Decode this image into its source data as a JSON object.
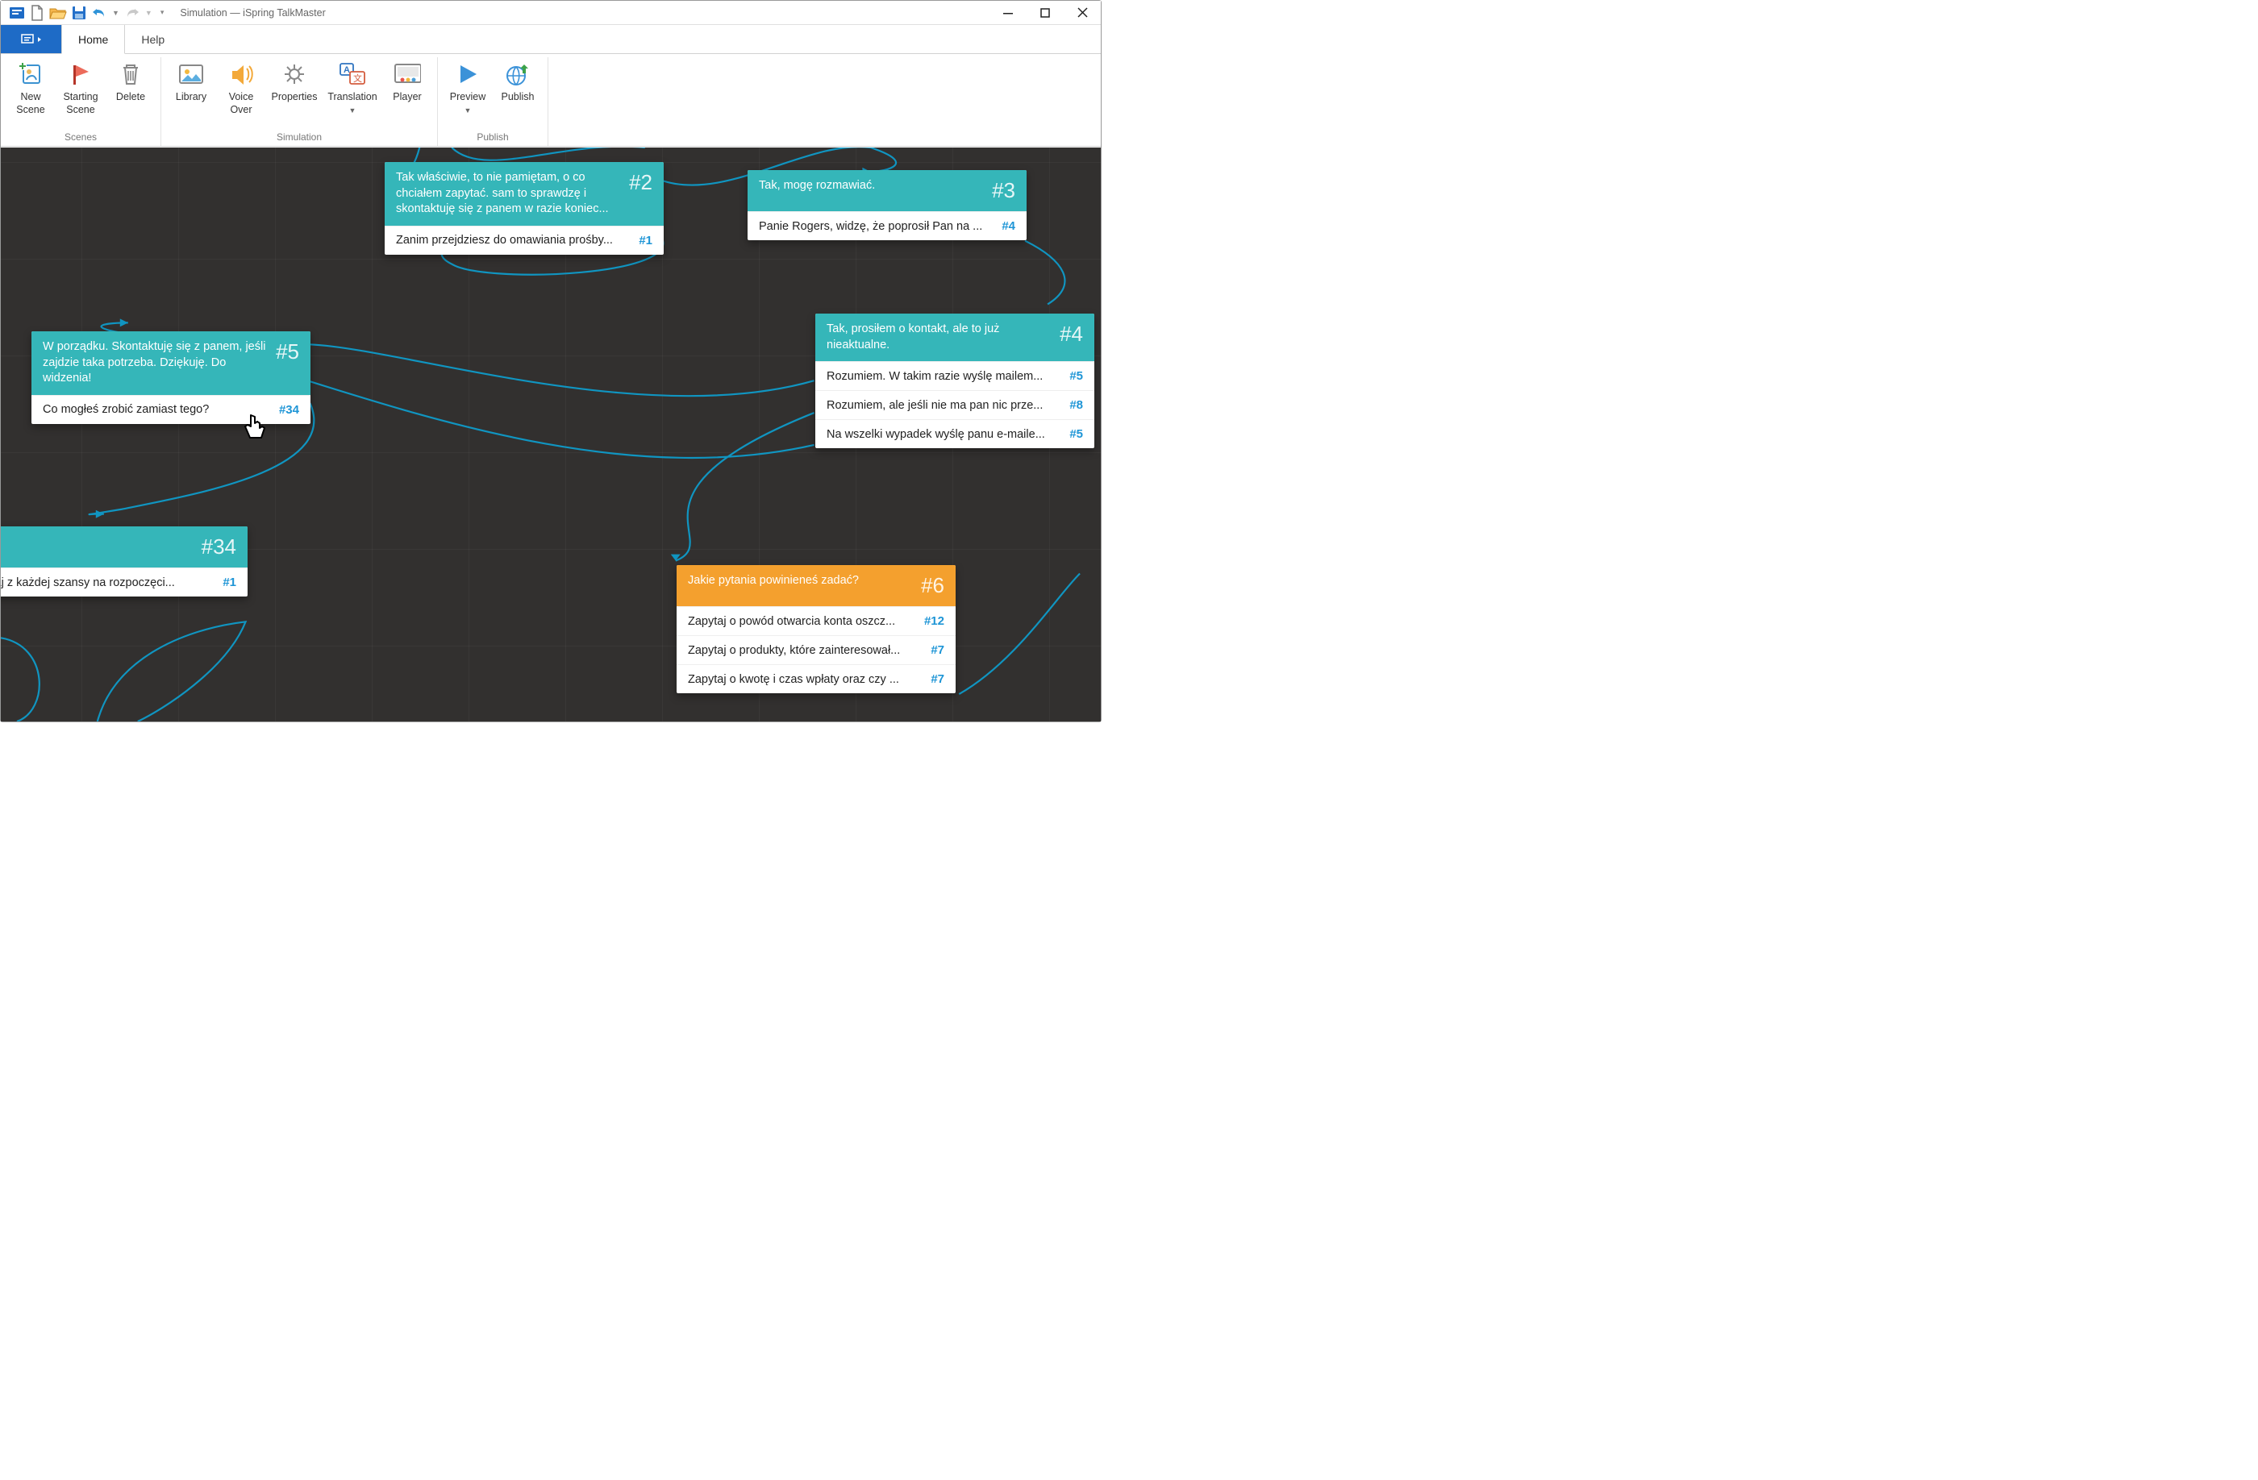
{
  "title": "Simulation — iSpring TalkMaster",
  "tabs": {
    "home": "Home",
    "help": "Help"
  },
  "ribbon": {
    "groups": {
      "scenes": "Scenes",
      "simulation": "Simulation",
      "publish": "Publish"
    },
    "buttons": {
      "newScene": "New\nScene",
      "startingScene": "Starting\nScene",
      "delete": "Delete",
      "library": "Library",
      "voiceOver": "Voice\nOver",
      "properties": "Properties",
      "translation": "Translation",
      "player": "Player",
      "preview": "Preview",
      "publish": "Publish"
    }
  },
  "nodes": {
    "n2": {
      "id": "#2",
      "title": "Tak właściwie, to nie pamiętam, o co chciałem zapytać. sam to sprawdzę i skontaktuję się z panem w razie koniec...",
      "rows": [
        {
          "text": "Zanim przejdziesz do omawiania prośby...",
          "id": "#1"
        }
      ]
    },
    "n3": {
      "id": "#3",
      "title": "Tak, mogę rozmawiać.",
      "rows": [
        {
          "text": "Panie Rogers, widzę, że poprosił Pan na ...",
          "id": "#4"
        }
      ]
    },
    "n4": {
      "id": "#4",
      "title": "Tak, prosiłem o kontakt, ale to już nieaktualne.",
      "rows": [
        {
          "text": "Rozumiem. W takim razie wyślę mailem...",
          "id": "#5"
        },
        {
          "text": "Rozumiem, ale jeśli nie ma pan nic prze...",
          "id": "#8"
        },
        {
          "text": "Na wszelki wypadek wyślę panu e-maile...",
          "id": "#5"
        }
      ]
    },
    "n5": {
      "id": "#5",
      "title": "W porządku. Skontaktuję się z panem, jeśli zajdzie taka potrzeba. Dziękuję. Do widzenia!",
      "rows": [
        {
          "text": "Co mogłeś zrobić zamiast tego?",
          "id": "#34"
        }
      ]
    },
    "n6": {
      "id": "#6",
      "title": "Jakie pytania powinieneś zadać?",
      "rows": [
        {
          "text": "Zapytaj o powód otwarcia konta oszcz...",
          "id": "#12"
        },
        {
          "text": "Zapytaj o produkty, które zainteresował...",
          "id": "#7"
        },
        {
          "text": "Zapytaj o kwotę i czas wpłaty oraz czy ...",
          "id": "#7"
        }
      ]
    },
    "n34": {
      "id": "#34",
      "title": "",
      "rows": [
        {
          "text": "ystaj z każdej szansy na rozpoczęci...",
          "id": "#1"
        }
      ]
    }
  }
}
